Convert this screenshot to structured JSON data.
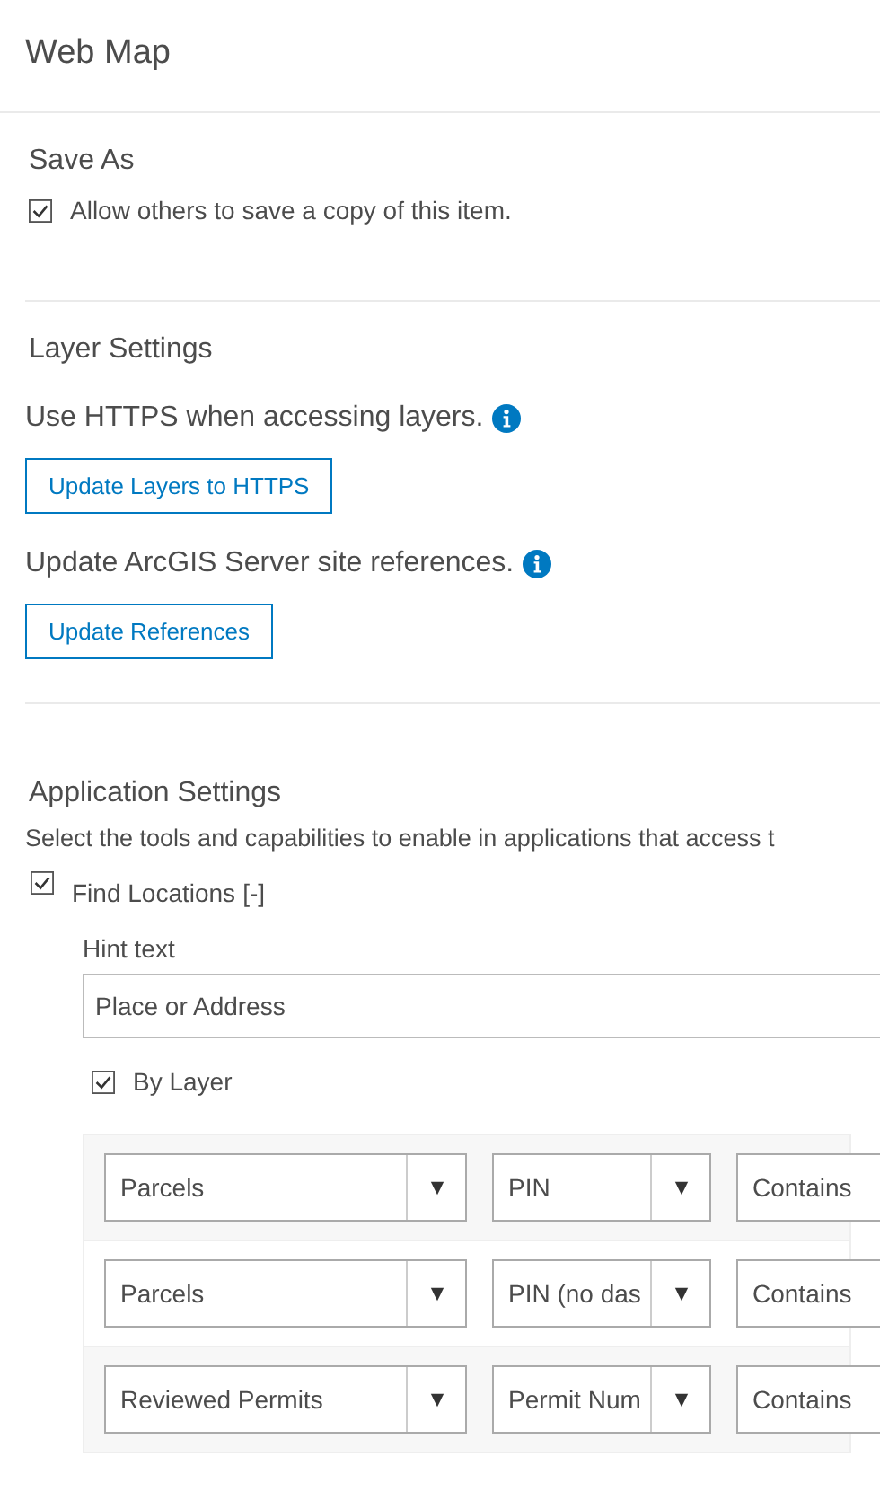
{
  "title": "Web Map",
  "save_as": {
    "heading": "Save As",
    "checkbox": {
      "label": "Allow others to save a copy of this item.",
      "checked": true
    }
  },
  "layer_settings": {
    "heading": "Layer Settings",
    "items": [
      {
        "text": "Use HTTPS when accessing layers.",
        "button": "Update Layers to HTTPS"
      },
      {
        "text": "Update ArcGIS Server site references.",
        "button": "Update References"
      }
    ]
  },
  "application_settings": {
    "heading": "Application Settings",
    "description": "Select the tools and capabilities to enable in applications that access t",
    "find_locations": {
      "label": "Find Locations",
      "toggle": "[-]",
      "checked": true,
      "hint": {
        "label": "Hint text",
        "value": "Place or Address"
      },
      "by_layer": {
        "label": "By Layer",
        "checked": true
      },
      "rows": [
        {
          "layer": "Parcels",
          "field": "PIN",
          "operator": "Contains"
        },
        {
          "layer": "Parcels",
          "field": "PIN (no das",
          "operator": "Contains"
        },
        {
          "layer": "Reviewed Permits",
          "field": "Permit Num",
          "operator": "Contains"
        }
      ]
    }
  }
}
